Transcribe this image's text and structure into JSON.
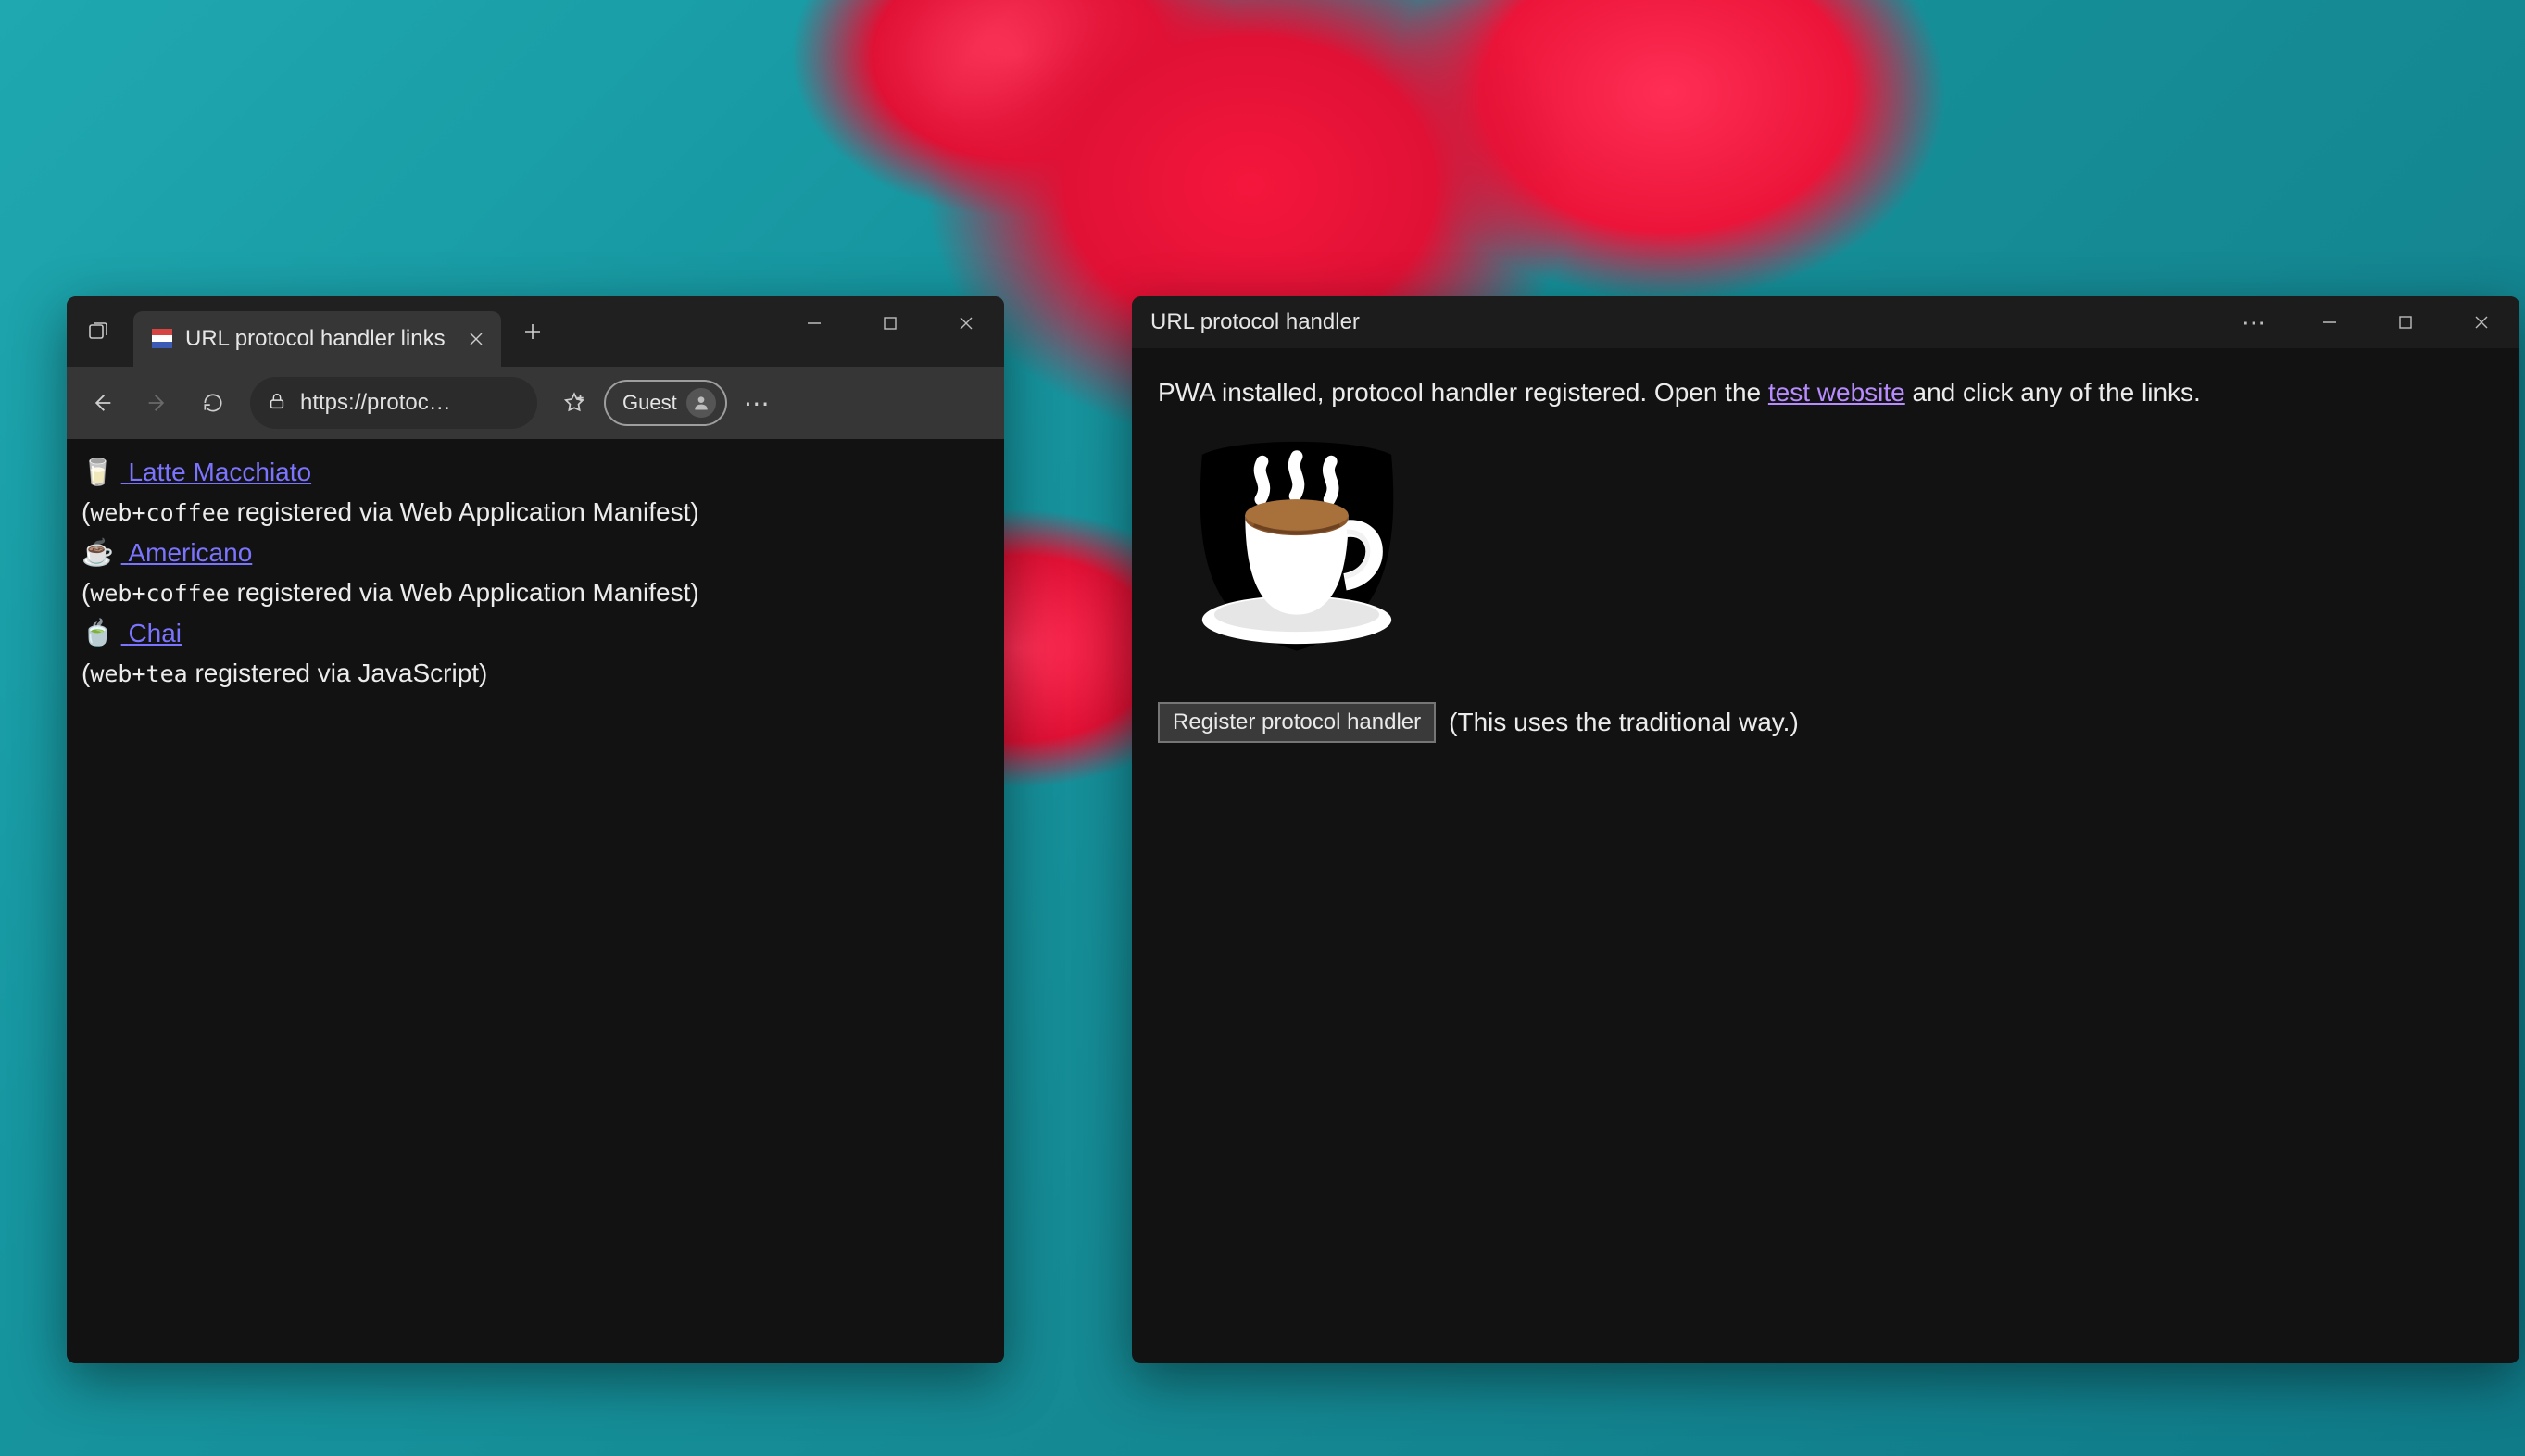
{
  "browser": {
    "tab_title": "URL protocol handler links",
    "address": "https://protoc…",
    "guest_label": "Guest",
    "links": [
      {
        "emoji": "🥛",
        "label": "Latte Macchiato",
        "note_prefix": "(",
        "proto": "web+coffee",
        "note_suffix": " registered via Web Application Manifest)"
      },
      {
        "emoji": "☕",
        "label": "Americano",
        "note_prefix": "(",
        "proto": "web+coffee",
        "note_suffix": " registered via Web Application Manifest)"
      },
      {
        "emoji": "🍵",
        "label": "Chai",
        "note_prefix": "(",
        "proto": "web+tea",
        "note_suffix": " registered via JavaScript)"
      }
    ]
  },
  "pwa": {
    "title": "URL protocol handler",
    "msg_before_link": "PWA installed, protocol handler registered. Open the ",
    "link_text": "test website",
    "msg_after_link": " and click any of the links.",
    "button_label": "Register protocol handler",
    "button_note": "(This uses the traditional way.)"
  }
}
